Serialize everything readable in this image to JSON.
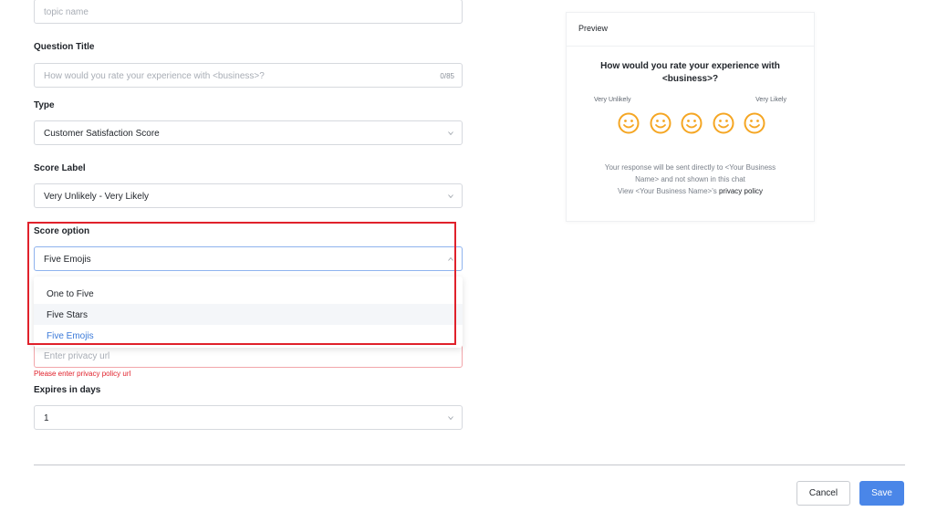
{
  "topic_field": {
    "placeholder": "topic name"
  },
  "question_title": {
    "label": "Question Title",
    "placeholder": "How would you rate your experience with <business>?",
    "counter": "0/85"
  },
  "type": {
    "label": "Type",
    "value": "Customer Satisfaction Score"
  },
  "score_label": {
    "label": "Score Label",
    "value": "Very Unlikely - Very Likely"
  },
  "score_option": {
    "label": "Score option",
    "value": "Five Emojis",
    "options": [
      "One to Five",
      "Five Stars",
      "Five Emojis"
    ]
  },
  "privacy": {
    "placeholder": "Enter privacy url",
    "error": "Please enter privacy policy url"
  },
  "expires": {
    "label": "Expires in days",
    "value": "1"
  },
  "buttons": {
    "cancel": "Cancel",
    "save": "Save"
  },
  "preview": {
    "title": "Preview",
    "question_line1": "How would you rate your experience with",
    "question_line2": "<business>?",
    "low_label": "Very Unlikely",
    "high_label": "Very Likely",
    "emoji_count": 5,
    "emoji_color": "#f5a623",
    "footer_line1": "Your response will be sent directly to <Your Business",
    "footer_line2": "Name> and not shown in this chat",
    "footer_line3_prefix": "View <Your Business Name>'s ",
    "footer_link": "privacy policy"
  },
  "colors": {
    "accent": "#4a86e8",
    "error": "#e0212b",
    "selected_option": "#3b7ad9"
  }
}
